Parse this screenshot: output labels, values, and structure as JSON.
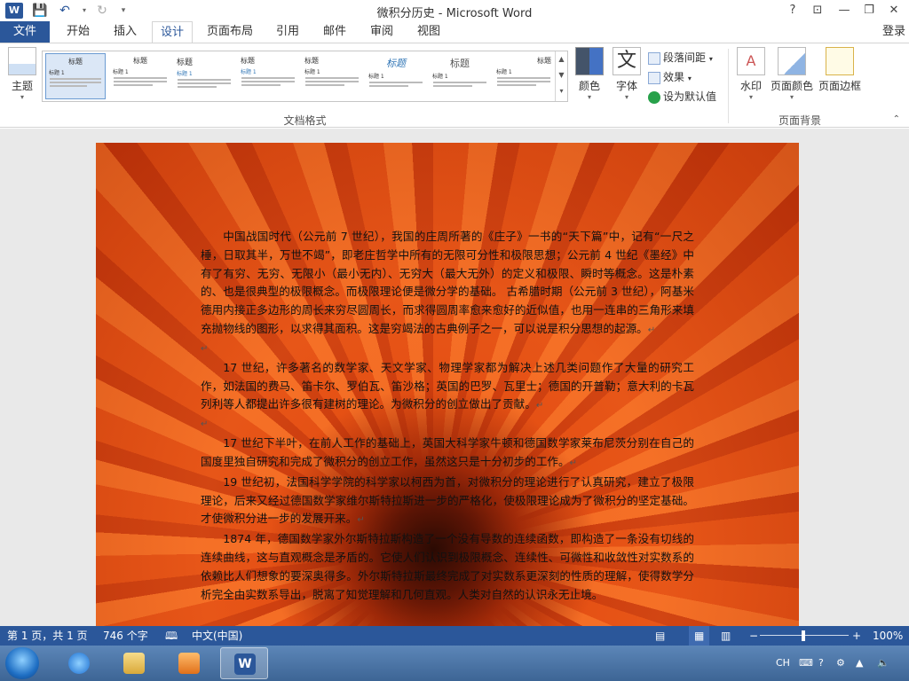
{
  "window": {
    "title": "微积分历史 - Microsoft Word",
    "app_logo": "W",
    "quick_access": [
      "save-icon",
      "undo-icon",
      "redo-icon",
      "customize-icon"
    ],
    "controls": {
      "help": "?",
      "ribbon_options": "⊡",
      "minimize": "—",
      "restore": "❐",
      "close": "✕"
    }
  },
  "tabs": {
    "file": "文件",
    "items": [
      "开始",
      "插入",
      "设计",
      "页面布局",
      "引用",
      "邮件",
      "审阅",
      "视图"
    ],
    "active": "设计",
    "login": "登录"
  },
  "ribbon": {
    "theme_button": "主题",
    "gallery": {
      "thumbs": [
        {
          "title": "标题",
          "subtitle": "标题 1"
        },
        {
          "title": "标题",
          "subtitle": "标题 1"
        },
        {
          "title": "标题",
          "subtitle": "标题 1"
        },
        {
          "title": "标题",
          "subtitle": "标题 1"
        },
        {
          "title": "标题",
          "subtitle": "标题 1"
        },
        {
          "title": "标题",
          "subtitle": "标题 1"
        },
        {
          "title": "标题",
          "subtitle": "标题 1"
        },
        {
          "title": "标题",
          "subtitle": "标题 1"
        }
      ],
      "group_label": "文档格式"
    },
    "colors_button": "颜色",
    "fonts_button": "字体",
    "fonts_glyph": "文",
    "paragraph_spacing": "段落间距",
    "effects": "效果",
    "set_default": "设为默认值",
    "watermark": "水印",
    "page_color": "页面颜色",
    "page_borders": "页面边框",
    "page_background_label": "页面背景"
  },
  "document": {
    "paragraphs": [
      "中国战国时代（公元前 7 世纪），我国的庄周所著的《庄子》一书的“天下篇”中，记有“一尺之棰，日取其半，万世不竭”，即老庄哲学中所有的无限可分性和极限思想；公元前 4 世纪《墨经》中有了有穷、无穷、无限小（最小无内）、无穷大（最大无外）的定义和极限、瞬时等概念。这是朴素的、也是很典型的极限概念。而极限理论便是微分学的基础。   古希腊时期（公元前 3 世纪），阿基米德用内接正多边形的周长来穷尽圆周长，而求得圆周率愈来愈好的近似值，也用一连串的三角形来填充抛物线的图形，以求得其面积。这是穷竭法的古典例子之一，可以说是积分思想的起源。",
      "",
      "17 世纪，许多著名的数学家、天文学家、物理学家都为解决上述几类问题作了大量的研究工作，如法国的费马、笛卡尔、罗伯瓦、笛沙格；英国的巴罗、瓦里士；德国的开普勒；意大利的卡瓦列利等人都提出许多很有建树的理论。为微积分的创立做出了贡献。",
      "",
      "17 世纪下半叶，在前人工作的基础上，英国大科学家牛顿和德国数学家莱布尼茨分别在自己的国度里独自研究和完成了微积分的创立工作，虽然这只是十分初步的工作。",
      "19 世纪初，法国科学学院的科学家以柯西为首，对微积分的理论进行了认真研究，建立了极限理论，后来又经过德国数学家维尔斯特拉斯进一步的严格化，使极限理论成为了微积分的坚定基础。才使微积分进一步的发展开来。",
      "1874 年，德国数学家外尔斯特拉斯构造了一个没有导数的连续函数，即构造了一条没有切线的连续曲线，这与直观概念是矛盾的。它使人们认识到极限概念、连续性、可微性和收敛性对实数系的依赖比人们想象的要深奥得多。外尔斯特拉斯最终完成了对实数系更深刻的性质的理解，使得数学分析完全由实数系导出，脱离了知觉理解和几何直观。人类对自然的认识永无止境。"
    ]
  },
  "status": {
    "page": "第 1 页，共 1 页",
    "words": "746 个字",
    "language": "中文(中国)",
    "zoom": "100%",
    "zoom_value": 1.0
  },
  "taskbar": {
    "tray_lang": "CH"
  }
}
